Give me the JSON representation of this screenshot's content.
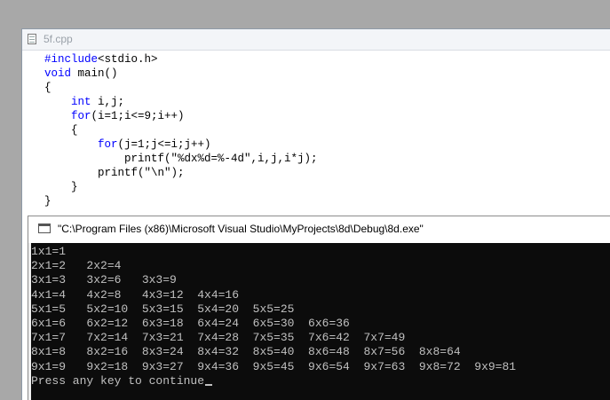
{
  "editor": {
    "title": "5f.cpp",
    "lines": [
      {
        "kw": "#include",
        "rest": "<stdio.h>",
        "indent": ""
      },
      {
        "kw": "void",
        "rest": " main()",
        "indent": ""
      },
      {
        "kw": "",
        "rest": "{",
        "indent": ""
      },
      {
        "kw": "int",
        "rest": " i,j;",
        "indent": "    "
      },
      {
        "kw": "for",
        "rest": "(i=1;i<=9;i++)",
        "indent": "    "
      },
      {
        "kw": "",
        "rest": "{",
        "indent": "    "
      },
      {
        "kw": "for",
        "rest": "(j=1;j<=i;j++)",
        "indent": "        "
      },
      {
        "kw": "",
        "rest": "printf(\"%dx%d=%-4d\",i,j,i*j);",
        "indent": "            "
      },
      {
        "kw": "",
        "rest": "printf(\"\\n\");",
        "indent": "        "
      },
      {
        "kw": "",
        "rest": "}",
        "indent": "    "
      },
      {
        "kw": "",
        "rest": "}",
        "indent": ""
      }
    ]
  },
  "console": {
    "title": "\"C:\\Program Files (x86)\\Microsoft Visual Studio\\MyProjects\\8d\\Debug\\8d.exe\"",
    "output_lines": [
      "1x1=1",
      "2x1=2   2x2=4",
      "3x1=3   3x2=6   3x3=9",
      "4x1=4   4x2=8   4x3=12  4x4=16",
      "5x1=5   5x2=10  5x3=15  5x4=20  5x5=25",
      "6x1=6   6x2=12  6x3=18  6x4=24  6x5=30  6x6=36",
      "7x1=7   7x2=14  7x3=21  7x4=28  7x5=35  7x6=42  7x7=49",
      "8x1=8   8x2=16  8x3=24  8x4=32  8x5=40  8x6=48  8x7=56  8x8=64",
      "9x1=9   9x2=18  9x3=27  9x4=36  9x5=45  9x6=54  9x7=63  9x8=72  9x9=81"
    ],
    "prompt": "Press any key to continue"
  },
  "colors": {
    "keyword": "#0000ff",
    "console_bg": "#0c0c0c",
    "console_text": "#c0c0c0"
  },
  "icons": {
    "editor": "document-icon",
    "console": "console-window-icon"
  }
}
